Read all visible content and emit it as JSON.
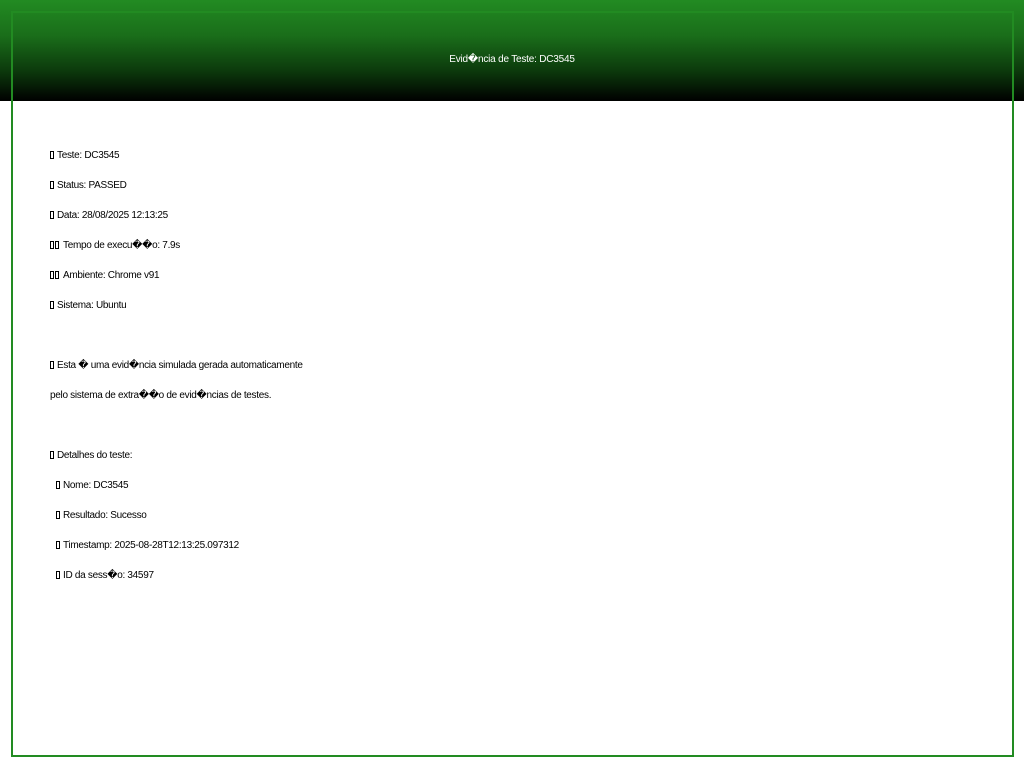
{
  "header": {
    "title": "Evid�ncia de Teste: DC3545"
  },
  "colors": {
    "accent": "#228b22",
    "header_gradient_start": "#228b22",
    "header_gradient_end": "#000000",
    "text": "#000000",
    "background": "#ffffff"
  },
  "summary": {
    "test": "Teste: DC3545",
    "status": "Status: PASSED",
    "date": "Data: 28/08/2025 12:13:25",
    "duration": "Tempo de execu��o: 7.9s",
    "environment": "Ambiente: Chrome v91",
    "system": "Sistema: Ubuntu"
  },
  "note": {
    "line1": "Esta � uma evid�ncia simulada gerada automaticamente",
    "line2": "pelo sistema de extra��o de evid�ncias de testes."
  },
  "details": {
    "heading": "Detalhes do teste:",
    "name": "Nome: DC3545",
    "result": "Resultado: Sucesso",
    "timestamp": "Timestamp: 2025-08-28T12:13:25.097312",
    "session": "ID da sess�o: 34597"
  }
}
